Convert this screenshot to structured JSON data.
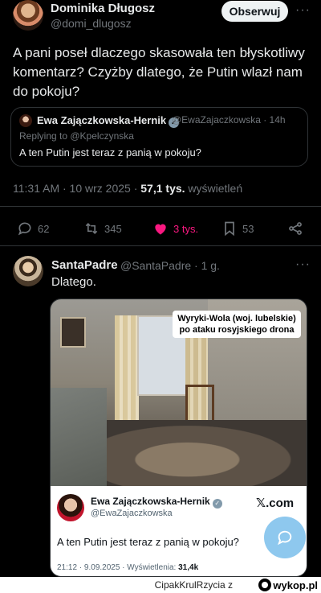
{
  "tweet": {
    "author_name": "Dominika Długosz",
    "author_handle": "@domi_dlugosz",
    "follow_label": "Obserwuj",
    "more": "···",
    "text": "A pani poseł dlaczego skasowała ten błyskotliwy komentarz? Czyżby dlatego, że Putin wlazł nam do pokoju?",
    "quote": {
      "author_name": "Ewa Zajączkowska-Hernik",
      "author_handle": "@EwaZajaczkowska · 14h",
      "replying_to": "Replying to @Kpelczynska",
      "text": "A ten Putin jest teraz z panią w pokoju?"
    },
    "time": "11:31 AM · 10 wrz 2025 · ",
    "views_count": "57,1 tys.",
    "views_label": " wyświetleń",
    "actions": {
      "replies": "62",
      "reposts": "345",
      "likes": "3 tys.",
      "bookmarks": "53"
    }
  },
  "reply": {
    "author_name": "SantaPadre",
    "author_handle": "@SantaPadre · 1 g.",
    "more": "···",
    "text": "Dlatego.",
    "photo_label": "Wyryki-Wola (woj. lubelskie) po ataku rosyjskiego drona",
    "card": {
      "author_name": "Ewa Zajączkowska-Hernik",
      "author_handle": "@EwaZajaczkowska",
      "brand": "𝕏.com",
      "text": "A ten Putin jest teraz z panią w pokoju?",
      "meta_prefix": "21:12 · 9.09.2025 · Wyświetlenia: ",
      "meta_views": "31,4k"
    }
  },
  "footer": {
    "credit": "CipakKrulRzycia  z",
    "site": "wykop.pl"
  },
  "colors": {
    "like": "#f91880",
    "muted": "#71767b"
  }
}
